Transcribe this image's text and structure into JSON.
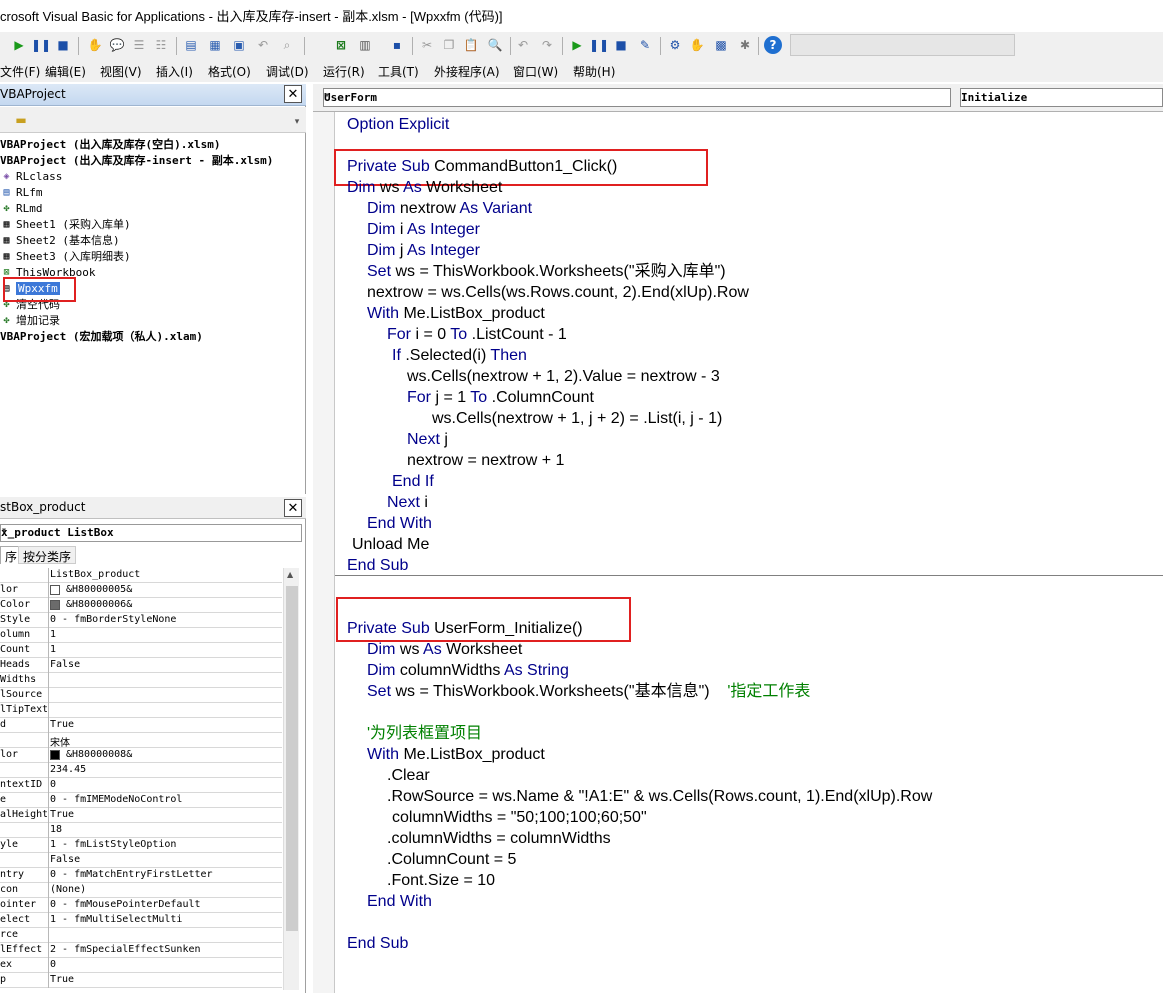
{
  "window": {
    "title": "crosoft Visual Basic for Applications - 出入库及库存-insert - 副本.xlsm - [Wpxxfm (代码)]"
  },
  "menu": [
    "文件(F)",
    "编辑(E)",
    "视图(V)",
    "插入(I)",
    "格式(O)",
    "调试(D)",
    "运行(R)",
    "工具(T)",
    "外接程序(A)",
    "窗口(W)",
    "帮助(H)"
  ],
  "project": {
    "title": "VBAProject",
    "nodes": [
      {
        "icon": "vbaproject-icon",
        "label": "VBAProject (出入库及库存(空白).xlsm)",
        "bold": true
      },
      {
        "icon": "vbaproject-icon",
        "label": "VBAProject (出入库及库存-insert - 副本.xlsm)",
        "bold": true
      },
      {
        "icon": "class-module-icon",
        "label": "RLclass",
        "bold": false
      },
      {
        "icon": "userform-icon",
        "label": "RLfm",
        "bold": false
      },
      {
        "icon": "module-icon",
        "label": "RLmd",
        "bold": false
      },
      {
        "icon": "worksheet-icon",
        "label": "Sheet1 (采购入库单)",
        "bold": false
      },
      {
        "icon": "worksheet-icon",
        "label": "Sheet2 (基本信息)",
        "bold": false
      },
      {
        "icon": "worksheet-icon",
        "label": "Sheet3 (入库明细表)",
        "bold": false
      },
      {
        "icon": "workbook-icon",
        "label": "ThisWorkbook",
        "bold": false
      },
      {
        "icon": "userform-icon",
        "label": "Wpxxfm",
        "bold": false,
        "selected": true
      },
      {
        "icon": "module-icon",
        "label": "清空代码",
        "bold": false
      },
      {
        "icon": "module-icon",
        "label": "增加记录",
        "bold": false
      },
      {
        "icon": "vbaproject-icon",
        "label": "VBAProject (宏加载项（私人).xlam)",
        "bold": true
      }
    ]
  },
  "properties": {
    "title": "stBox_product",
    "object": "x_product ListBox",
    "tabs": [
      "序",
      "按分类序"
    ],
    "rows": [
      {
        "name": "",
        "value": "ListBox_product"
      },
      {
        "name": "lor",
        "value": "&H80000005&",
        "swatch": "#ffffff"
      },
      {
        "name": "Color",
        "value": "&H80000006&",
        "swatch": "#6b6b6b"
      },
      {
        "name": "Style",
        "value": "0 - fmBorderStyleNone"
      },
      {
        "name": "olumn",
        "value": "1"
      },
      {
        "name": "Count",
        "value": "1"
      },
      {
        "name": "Heads",
        "value": "False"
      },
      {
        "name": "Widths",
        "value": ""
      },
      {
        "name": "lSource",
        "value": ""
      },
      {
        "name": "lTipText",
        "value": ""
      },
      {
        "name": "d",
        "value": "True"
      },
      {
        "name": "",
        "value": "宋体"
      },
      {
        "name": "lor",
        "value": "&H80000008&",
        "swatch": "#000000"
      },
      {
        "name": "",
        "value": "234.45"
      },
      {
        "name": "ntextID",
        "value": "0"
      },
      {
        "name": "e",
        "value": "0 - fmIMEModeNoControl"
      },
      {
        "name": "alHeight",
        "value": "True"
      },
      {
        "name": "",
        "value": "18"
      },
      {
        "name": "yle",
        "value": "1 - fmListStyleOption"
      },
      {
        "name": "",
        "value": "False"
      },
      {
        "name": "ntry",
        "value": "0 - fmMatchEntryFirstLetter"
      },
      {
        "name": "con",
        "value": "(None)"
      },
      {
        "name": "ointer",
        "value": "0 - fmMousePointerDefault"
      },
      {
        "name": "elect",
        "value": "1 - fmMultiSelectMulti"
      },
      {
        "name": "rce",
        "value": ""
      },
      {
        "name": "lEffect",
        "value": "2 - fmSpecialEffectSunken"
      },
      {
        "name": "ex",
        "value": "0"
      },
      {
        "name": "p",
        "value": "True"
      }
    ]
  },
  "code_window": {
    "object_combo": "UserForm",
    "proc_combo": "Initialize",
    "lines": [
      {
        "indent": 0,
        "segs": [
          [
            "k",
            "Option Explicit"
          ]
        ]
      },
      {
        "indent": 0,
        "segs": []
      },
      {
        "indent": 0,
        "segs": [
          [
            "k",
            "Private Sub "
          ],
          [
            "n",
            "CommandButton1_Click()"
          ]
        ]
      },
      {
        "indent": 0,
        "segs": [
          [
            "k",
            "Dim "
          ],
          [
            "n",
            "ws "
          ],
          [
            "k",
            "As "
          ],
          [
            "n",
            "Worksheet"
          ]
        ]
      },
      {
        "indent": 1,
        "segs": [
          [
            "k",
            "Dim "
          ],
          [
            "n",
            "nextrow "
          ],
          [
            "k",
            "As Variant"
          ]
        ]
      },
      {
        "indent": 1,
        "segs": [
          [
            "k",
            "Dim "
          ],
          [
            "n",
            "i "
          ],
          [
            "k",
            "As Integer"
          ]
        ]
      },
      {
        "indent": 1,
        "segs": [
          [
            "k",
            "Dim "
          ],
          [
            "n",
            "j "
          ],
          [
            "k",
            "As Integer"
          ]
        ]
      },
      {
        "indent": 1,
        "segs": [
          [
            "k",
            "Set "
          ],
          [
            "n",
            "ws = ThisWorkbook.Worksheets(\"采购入库单\")"
          ]
        ]
      },
      {
        "indent": 1,
        "segs": [
          [
            "n",
            "nextrow = ws.Cells(ws.Rows.count, 2).End(xlUp).Row"
          ]
        ]
      },
      {
        "indent": 1,
        "segs": [
          [
            "k",
            "With "
          ],
          [
            "n",
            "Me.ListBox_product"
          ]
        ]
      },
      {
        "indent": 2,
        "segs": [
          [
            "k",
            "For "
          ],
          [
            "n",
            "i = 0 "
          ],
          [
            "k",
            "To "
          ],
          [
            "n",
            ".ListCount - 1"
          ]
        ]
      },
      {
        "indent": 2.25,
        "segs": [
          [
            "k",
            "If "
          ],
          [
            "n",
            ".Selected(i) "
          ],
          [
            "k",
            "Then"
          ]
        ]
      },
      {
        "indent": 3,
        "segs": [
          [
            "n",
            "ws.Cells(nextrow + 1, 2).Value = nextrow - 3"
          ]
        ]
      },
      {
        "indent": 3,
        "segs": [
          [
            "k",
            "For "
          ],
          [
            "n",
            "j = 1 "
          ],
          [
            "k",
            "To "
          ],
          [
            "n",
            ".ColumnCount"
          ]
        ]
      },
      {
        "indent": 4.25,
        "segs": [
          [
            "n",
            "ws.Cells(nextrow + 1, j + 2) = .List(i, j - 1)"
          ]
        ]
      },
      {
        "indent": 3,
        "segs": [
          [
            "k",
            "Next "
          ],
          [
            "n",
            "j"
          ]
        ]
      },
      {
        "indent": 3,
        "segs": [
          [
            "n",
            "nextrow = nextrow + 1"
          ]
        ]
      },
      {
        "indent": 2.25,
        "segs": [
          [
            "k",
            "End If"
          ]
        ]
      },
      {
        "indent": 2,
        "segs": [
          [
            "k",
            "Next "
          ],
          [
            "n",
            "i"
          ]
        ]
      },
      {
        "indent": 1,
        "segs": [
          [
            "k",
            "End With"
          ]
        ]
      },
      {
        "indent": 0.25,
        "segs": [
          [
            "n",
            "Unload Me"
          ]
        ]
      },
      {
        "indent": 0,
        "segs": [
          [
            "k",
            "End Sub"
          ]
        ]
      },
      {
        "indent": 0,
        "segs": []
      },
      {
        "indent": 0,
        "segs": []
      },
      {
        "indent": 0,
        "segs": [
          [
            "k",
            "Private Sub "
          ],
          [
            "n",
            "UserForm_Initialize()"
          ]
        ]
      },
      {
        "indent": 1,
        "segs": [
          [
            "k",
            "Dim "
          ],
          [
            "n",
            "ws "
          ],
          [
            "k",
            "As "
          ],
          [
            "n",
            "Worksheet"
          ]
        ]
      },
      {
        "indent": 1,
        "segs": [
          [
            "k",
            "Dim "
          ],
          [
            "n",
            "columnWidths "
          ],
          [
            "k",
            "As String"
          ]
        ]
      },
      {
        "indent": 1,
        "segs": [
          [
            "k",
            "Set "
          ],
          [
            "n",
            "ws = ThisWorkbook.Worksheets(\"基本信息\")    "
          ],
          [
            "c",
            "'指定工作表"
          ]
        ]
      },
      {
        "indent": 0,
        "segs": []
      },
      {
        "indent": 1,
        "segs": [
          [
            "c",
            "'为列表框置项目"
          ]
        ]
      },
      {
        "indent": 1,
        "segs": [
          [
            "k",
            "With "
          ],
          [
            "n",
            "Me.ListBox_product"
          ]
        ]
      },
      {
        "indent": 2,
        "segs": [
          [
            "n",
            ".Clear"
          ]
        ]
      },
      {
        "indent": 2,
        "segs": [
          [
            "n",
            ".RowSource = ws.Name & \"!A1:E\" & ws.Cells(Rows.count, 1).End(xlUp).Row"
          ]
        ]
      },
      {
        "indent": 2.25,
        "segs": [
          [
            "n",
            "columnWidths = \"50;100;100;60;50\""
          ]
        ]
      },
      {
        "indent": 2,
        "segs": [
          [
            "n",
            ".columnWidths = columnWidths"
          ]
        ]
      },
      {
        "indent": 2,
        "segs": [
          [
            "n",
            ".ColumnCount = 5"
          ]
        ]
      },
      {
        "indent": 2,
        "segs": [
          [
            "n",
            ".Font.Size = 10"
          ]
        ]
      },
      {
        "indent": 1,
        "segs": [
          [
            "k",
            "End With"
          ]
        ]
      },
      {
        "indent": 0,
        "segs": []
      },
      {
        "indent": 0,
        "segs": [
          [
            "k",
            "End Sub"
          ]
        ]
      }
    ]
  },
  "colors": {
    "keyword": "#00008b",
    "comment": "#008000",
    "highlight_box": "#e02020",
    "selection": "#3c78d8"
  }
}
